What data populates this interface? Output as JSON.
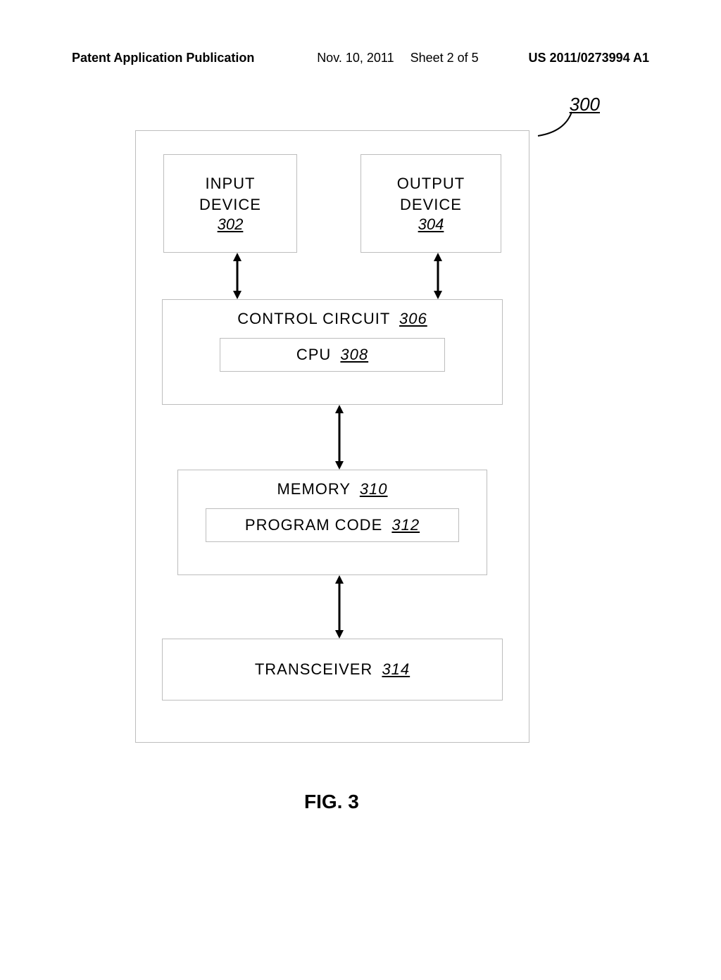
{
  "header": {
    "left": "Patent Application Publication",
    "date": "Nov. 10, 2011",
    "sheet": "Sheet 2 of 5",
    "docnum": "US 2011/0273994 A1"
  },
  "ref": {
    "assembly": "300"
  },
  "blocks": {
    "input": {
      "label": "INPUT\nDEVICE",
      "num": "302"
    },
    "output": {
      "label": "OUTPUT\nDEVICE",
      "num": "304"
    },
    "control": {
      "label": "CONTROL CIRCUIT",
      "num": "306",
      "cpu": {
        "label": "CPU",
        "num": "308"
      }
    },
    "memory": {
      "label": "MEMORY",
      "num": "310",
      "code": {
        "label": "PROGRAM CODE",
        "num": "312"
      }
    },
    "txrx": {
      "label": "TRANSCEIVER",
      "num": "314"
    }
  },
  "figure": {
    "caption": "FIG. 3"
  }
}
